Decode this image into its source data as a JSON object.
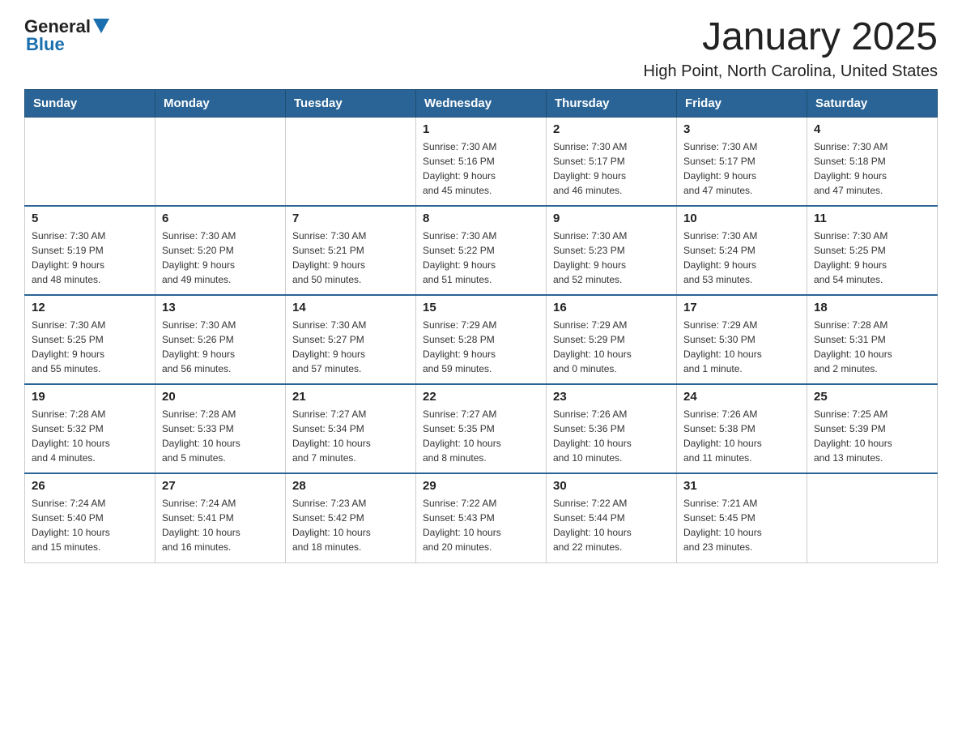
{
  "header": {
    "logo_general": "General",
    "logo_blue": "Blue",
    "month_title": "January 2025",
    "location": "High Point, North Carolina, United States"
  },
  "days_of_week": [
    "Sunday",
    "Monday",
    "Tuesday",
    "Wednesday",
    "Thursday",
    "Friday",
    "Saturday"
  ],
  "weeks": [
    [
      {
        "day": "",
        "info": ""
      },
      {
        "day": "",
        "info": ""
      },
      {
        "day": "",
        "info": ""
      },
      {
        "day": "1",
        "info": "Sunrise: 7:30 AM\nSunset: 5:16 PM\nDaylight: 9 hours\nand 45 minutes."
      },
      {
        "day": "2",
        "info": "Sunrise: 7:30 AM\nSunset: 5:17 PM\nDaylight: 9 hours\nand 46 minutes."
      },
      {
        "day": "3",
        "info": "Sunrise: 7:30 AM\nSunset: 5:17 PM\nDaylight: 9 hours\nand 47 minutes."
      },
      {
        "day": "4",
        "info": "Sunrise: 7:30 AM\nSunset: 5:18 PM\nDaylight: 9 hours\nand 47 minutes."
      }
    ],
    [
      {
        "day": "5",
        "info": "Sunrise: 7:30 AM\nSunset: 5:19 PM\nDaylight: 9 hours\nand 48 minutes."
      },
      {
        "day": "6",
        "info": "Sunrise: 7:30 AM\nSunset: 5:20 PM\nDaylight: 9 hours\nand 49 minutes."
      },
      {
        "day": "7",
        "info": "Sunrise: 7:30 AM\nSunset: 5:21 PM\nDaylight: 9 hours\nand 50 minutes."
      },
      {
        "day": "8",
        "info": "Sunrise: 7:30 AM\nSunset: 5:22 PM\nDaylight: 9 hours\nand 51 minutes."
      },
      {
        "day": "9",
        "info": "Sunrise: 7:30 AM\nSunset: 5:23 PM\nDaylight: 9 hours\nand 52 minutes."
      },
      {
        "day": "10",
        "info": "Sunrise: 7:30 AM\nSunset: 5:24 PM\nDaylight: 9 hours\nand 53 minutes."
      },
      {
        "day": "11",
        "info": "Sunrise: 7:30 AM\nSunset: 5:25 PM\nDaylight: 9 hours\nand 54 minutes."
      }
    ],
    [
      {
        "day": "12",
        "info": "Sunrise: 7:30 AM\nSunset: 5:25 PM\nDaylight: 9 hours\nand 55 minutes."
      },
      {
        "day": "13",
        "info": "Sunrise: 7:30 AM\nSunset: 5:26 PM\nDaylight: 9 hours\nand 56 minutes."
      },
      {
        "day": "14",
        "info": "Sunrise: 7:30 AM\nSunset: 5:27 PM\nDaylight: 9 hours\nand 57 minutes."
      },
      {
        "day": "15",
        "info": "Sunrise: 7:29 AM\nSunset: 5:28 PM\nDaylight: 9 hours\nand 59 minutes."
      },
      {
        "day": "16",
        "info": "Sunrise: 7:29 AM\nSunset: 5:29 PM\nDaylight: 10 hours\nand 0 minutes."
      },
      {
        "day": "17",
        "info": "Sunrise: 7:29 AM\nSunset: 5:30 PM\nDaylight: 10 hours\nand 1 minute."
      },
      {
        "day": "18",
        "info": "Sunrise: 7:28 AM\nSunset: 5:31 PM\nDaylight: 10 hours\nand 2 minutes."
      }
    ],
    [
      {
        "day": "19",
        "info": "Sunrise: 7:28 AM\nSunset: 5:32 PM\nDaylight: 10 hours\nand 4 minutes."
      },
      {
        "day": "20",
        "info": "Sunrise: 7:28 AM\nSunset: 5:33 PM\nDaylight: 10 hours\nand 5 minutes."
      },
      {
        "day": "21",
        "info": "Sunrise: 7:27 AM\nSunset: 5:34 PM\nDaylight: 10 hours\nand 7 minutes."
      },
      {
        "day": "22",
        "info": "Sunrise: 7:27 AM\nSunset: 5:35 PM\nDaylight: 10 hours\nand 8 minutes."
      },
      {
        "day": "23",
        "info": "Sunrise: 7:26 AM\nSunset: 5:36 PM\nDaylight: 10 hours\nand 10 minutes."
      },
      {
        "day": "24",
        "info": "Sunrise: 7:26 AM\nSunset: 5:38 PM\nDaylight: 10 hours\nand 11 minutes."
      },
      {
        "day": "25",
        "info": "Sunrise: 7:25 AM\nSunset: 5:39 PM\nDaylight: 10 hours\nand 13 minutes."
      }
    ],
    [
      {
        "day": "26",
        "info": "Sunrise: 7:24 AM\nSunset: 5:40 PM\nDaylight: 10 hours\nand 15 minutes."
      },
      {
        "day": "27",
        "info": "Sunrise: 7:24 AM\nSunset: 5:41 PM\nDaylight: 10 hours\nand 16 minutes."
      },
      {
        "day": "28",
        "info": "Sunrise: 7:23 AM\nSunset: 5:42 PM\nDaylight: 10 hours\nand 18 minutes."
      },
      {
        "day": "29",
        "info": "Sunrise: 7:22 AM\nSunset: 5:43 PM\nDaylight: 10 hours\nand 20 minutes."
      },
      {
        "day": "30",
        "info": "Sunrise: 7:22 AM\nSunset: 5:44 PM\nDaylight: 10 hours\nand 22 minutes."
      },
      {
        "day": "31",
        "info": "Sunrise: 7:21 AM\nSunset: 5:45 PM\nDaylight: 10 hours\nand 23 minutes."
      },
      {
        "day": "",
        "info": ""
      }
    ]
  ]
}
